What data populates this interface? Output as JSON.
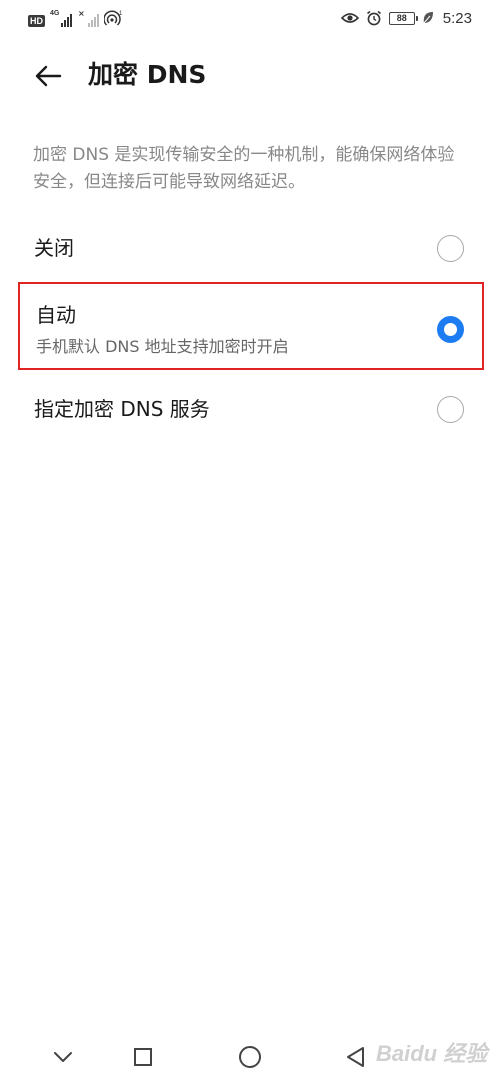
{
  "status_bar": {
    "hd_badge": "HD",
    "network_type": "4G",
    "time": "5:23",
    "battery_level": "88",
    "icons": [
      "hd-icon",
      "signal-icon",
      "signal-icon",
      "hotspot-icon",
      "eye-icon",
      "alarm-icon",
      "battery-icon",
      "leaf-icon"
    ]
  },
  "header": {
    "title": "加密 DNS",
    "back_icon": "arrow-left-icon"
  },
  "description": "加密 DNS 是实现传输安全的一种机制，能确保网络体验安全，但连接后可能导致网络延迟。",
  "options": [
    {
      "label": "关闭",
      "subtitle": "",
      "selected": false
    },
    {
      "label": "自动",
      "subtitle": "手机默认 DNS 地址支持加密时开启",
      "selected": true
    },
    {
      "label": "指定加密 DNS 服务",
      "subtitle": "",
      "selected": false
    }
  ],
  "nav_bar": {
    "icons": [
      "chevron-down-icon",
      "square-icon",
      "circle-icon",
      "triangle-back-icon"
    ]
  },
  "watermark": "Baidu 经验",
  "colors": {
    "accent": "#1e7cf2",
    "highlight_border": "#e02424",
    "description_text": "#888888"
  }
}
